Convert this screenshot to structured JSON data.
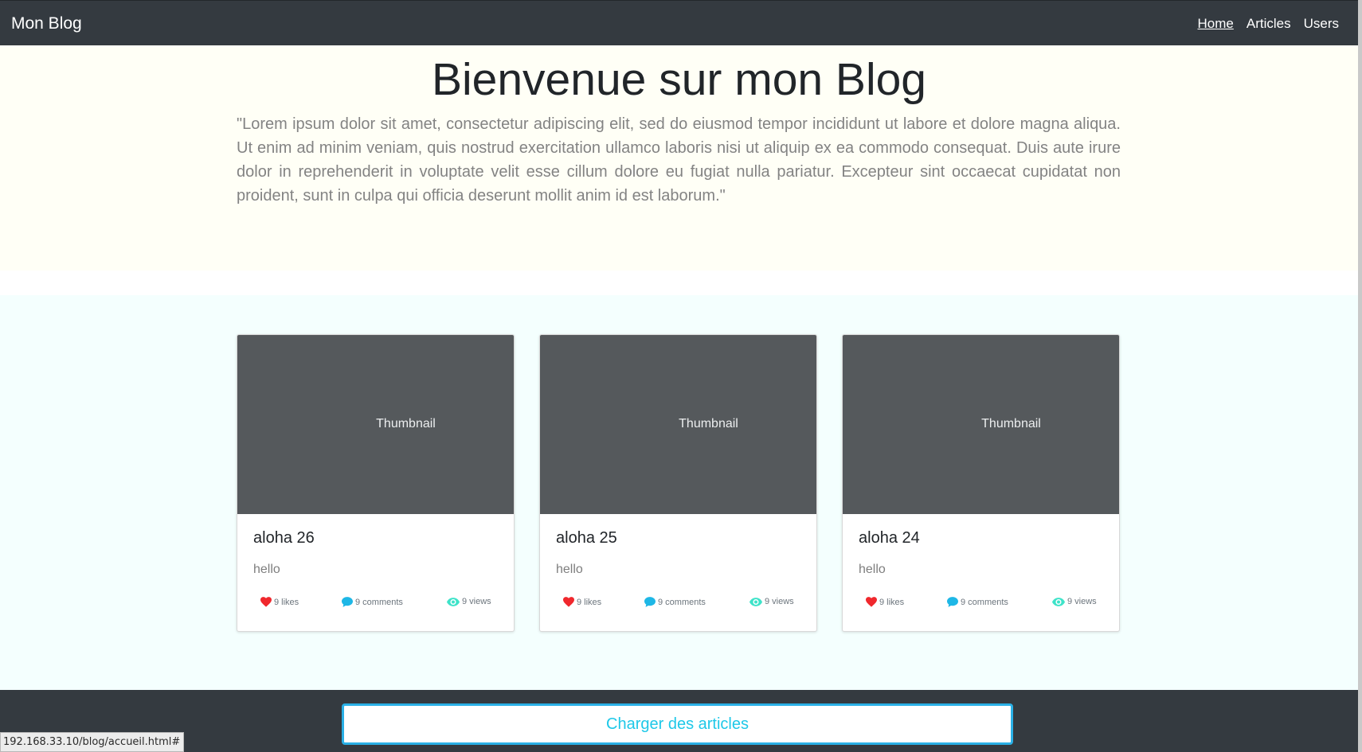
{
  "navbar": {
    "brand": "Mon Blog",
    "links": [
      {
        "label": "Home",
        "active": true
      },
      {
        "label": "Articles",
        "active": false
      },
      {
        "label": "Users",
        "active": false
      }
    ]
  },
  "hero": {
    "title": "Bienvenue sur mon Blog",
    "lead": "\"Lorem ipsum dolor sit amet, consectetur adipiscing elit, sed do eiusmod tempor incididunt ut labore et dolore magna aliqua. Ut enim ad minim veniam, quis nostrud exercitation ullamco laboris nisi ut aliquip ex ea commodo consequat. Duis aute irure dolor in reprehenderit in voluptate velit esse cillum dolore eu fugiat nulla pariatur. Excepteur sint occaecat cupidatat non proident, sunt in culpa qui officia deserunt mollit anim id est laborum.\""
  },
  "cards": [
    {
      "thumbnail": "Thumbnail",
      "title": "aloha 26",
      "text": "hello",
      "likes": "9 likes",
      "comments": "9 comments",
      "views": "9 views"
    },
    {
      "thumbnail": "Thumbnail",
      "title": "aloha 25",
      "text": "hello",
      "likes": "9 likes",
      "comments": "9 comments",
      "views": "9 views"
    },
    {
      "thumbnail": "Thumbnail",
      "title": "aloha 24",
      "text": "hello",
      "likes": "9 likes",
      "comments": "9 comments",
      "views": "9 views"
    }
  ],
  "icons": {
    "likes": "heart-icon",
    "comments": "comment-icon",
    "views": "eye-icon"
  },
  "colors": {
    "heart": "#f0282d",
    "comment": "#1eb7e6",
    "eye": "#3ee3c9",
    "accent": "#1ec8e8",
    "navbar": "#343a40"
  },
  "footer": {
    "load_button": "Charger des articles"
  },
  "statusbar": {
    "url": "192.168.33.10/blog/accueil.html#"
  }
}
